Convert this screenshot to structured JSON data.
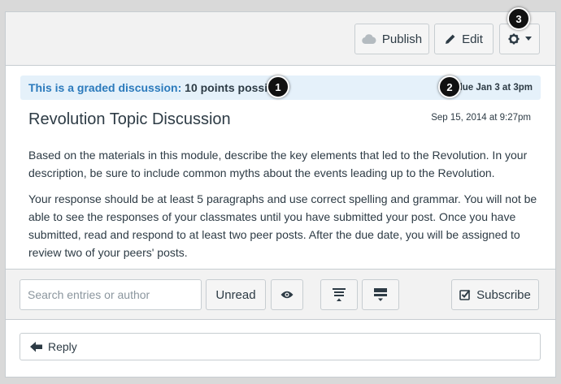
{
  "toolbar": {
    "publish_label": "Publish",
    "edit_label": "Edit"
  },
  "graded": {
    "label": "This is a graded discussion:",
    "points": "10 points possible",
    "due": "due Jan 3 at 3pm"
  },
  "topic": {
    "title": "Revolution Topic Discussion",
    "posted": "Sep 15, 2014 at 9:27pm",
    "paragraphs": [
      "Based on the materials in this module, describe the key elements that led to the Revolution. In your description, be sure to include common myths about the events leading up to the Revolution.",
      "Your response should be at least 5 paragraphs and use correct spelling and grammar. You will not be able to see the responses of your classmates until you have submitted your post. Once you have submitted, read and respond to at least two peer posts. After the due date, you will be assigned to review two of your peers' posts."
    ]
  },
  "filters": {
    "search_placeholder": "Search entries or author",
    "unread_label": "Unread",
    "subscribe_label": "Subscribe"
  },
  "reply": {
    "label": "Reply"
  },
  "callouts": [
    "1",
    "2",
    "3"
  ],
  "colors": {
    "accent_blue": "#2b7abc",
    "graded_bg": "#e5f1fa",
    "toolbar_bg": "#f2f2f2",
    "border": "#c7cdd1"
  }
}
